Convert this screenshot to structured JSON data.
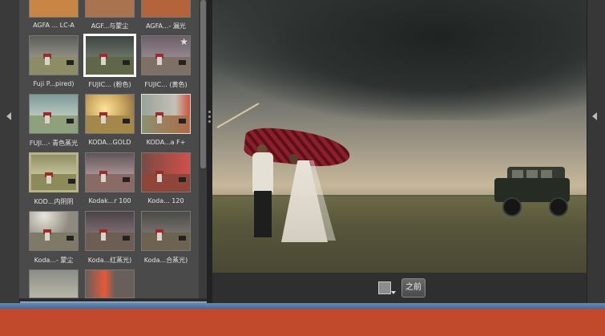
{
  "filters": {
    "items": [
      {
        "label": "AGFA ... LC-A"
      },
      {
        "label": "AGF...与蒙尘"
      },
      {
        "label": "AGFA...- 漏光"
      },
      {
        "label": "Fuji P...pired)"
      },
      {
        "label": "FUJIC... (粉色)",
        "selected": true
      },
      {
        "label": "FUJIC... (黄色)",
        "starred": true
      },
      {
        "label": "FUJI...- 青色蒸光"
      },
      {
        "label": "KODA...GOLD"
      },
      {
        "label": "KODA...a F+"
      },
      {
        "label": "KOD...内阴阴"
      },
      {
        "label": "Kodak...r 100"
      },
      {
        "label": "Koda... 120"
      },
      {
        "label": "Koda...- 蒙尘"
      },
      {
        "label": "Koda...红蒸光)"
      },
      {
        "label": "Koda...合蒸光)"
      },
      {
        "label": ""
      },
      {
        "label": ""
      }
    ]
  },
  "icons": {
    "star": "★",
    "left_arrow": "arrow-left-icon",
    "right_arrow": "arrow-right-icon"
  },
  "bottom_bar": {
    "before_label": "之前"
  },
  "colors": {
    "desktop": "#c24a2c",
    "panel": "#4a4a4a",
    "selection_border": "#ffffff"
  }
}
